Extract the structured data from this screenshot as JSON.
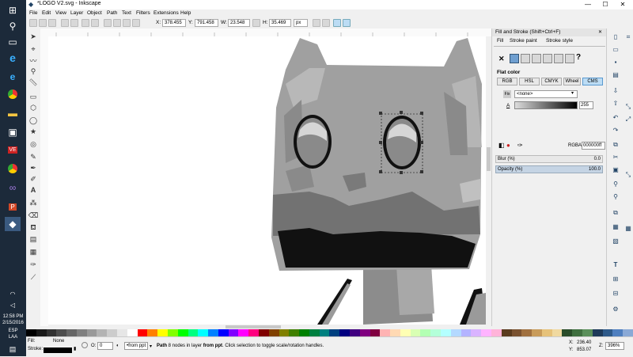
{
  "window": {
    "title": "*LOGO V2.svg - Inkscape",
    "controls": [
      "—",
      "☐",
      "✕"
    ]
  },
  "menu": [
    "File",
    "Edit",
    "View",
    "Layer",
    "Object",
    "Path",
    "Text",
    "Filters",
    "Extensions",
    "Help"
  ],
  "toolbar": {
    "x_label": "X:",
    "x_value": "378.455",
    "y_label": "Y:",
    "y_value": "791.458",
    "w_label": "W:",
    "w_value": "23.548",
    "h_label": "H:",
    "h_value": "35.469",
    "unit": "px"
  },
  "dialog": {
    "title": "Fill and Stroke (Shift+Ctrl+F)",
    "tabs": [
      "Fill",
      "Stroke paint",
      "Stroke style"
    ],
    "x_mark": "✕",
    "question_mark": "?",
    "flat_color_label": "Flat color",
    "color_modes": [
      "RGB",
      "HSL",
      "CMYK",
      "Wheel",
      "CMS"
    ],
    "none_option": "<none>",
    "alpha_label": "A",
    "alpha_value": "255",
    "rgba_label": "RGBA:",
    "rgba_value": "000000ff",
    "blur_label": "Blur (%)",
    "blur_value": "0.0",
    "opacity_label": "Opacity (%)",
    "opacity_value": "100.0"
  },
  "status": {
    "fill_label": "Fill:",
    "fill_value": "None",
    "stroke_label": "Stroke:",
    "opacity_label": "O:",
    "opacity_value": "0",
    "layer": "•from ppt",
    "message_prefix": "Path",
    "message_mid": " 8 nodes in layer ",
    "message_layer": "from ppt",
    "message_suffix": ". Click selection to toggle scale/rotation handles.",
    "x_label": "X:",
    "x_value": "236.40",
    "y_label": "Y:",
    "y_value": "853.07",
    "z_label": "Z:",
    "zoom_value": "396%"
  },
  "taskbar": {
    "time": "12:58 PM",
    "date": "2/15/2016",
    "lang1": "ESP",
    "lang2": "LAA"
  },
  "palette_colors": [
    "#000000",
    "#1a1a1a",
    "#333333",
    "#4d4d4d",
    "#666666",
    "#808080",
    "#999999",
    "#b3b3b3",
    "#cccccc",
    "#e6e6e6",
    "#ffffff",
    "#ff0000",
    "#ff8000",
    "#ffff00",
    "#80ff00",
    "#00ff00",
    "#00ff80",
    "#00ffff",
    "#0080ff",
    "#0000ff",
    "#8000ff",
    "#ff00ff",
    "#ff0080",
    "#800000",
    "#804000",
    "#808000",
    "#408000",
    "#008000",
    "#008040",
    "#008080",
    "#004080",
    "#000080",
    "#400080",
    "#800080",
    "#800040",
    "#ffb3b3",
    "#ffd9b3",
    "#ffffb3",
    "#d9ffb3",
    "#b3ffb3",
    "#b3ffd9",
    "#b3ffff",
    "#b3d9ff",
    "#b3b3ff",
    "#d9b3ff",
    "#ffb3ff",
    "#ffb3d9",
    "#5a3b1e",
    "#7a5230",
    "#a0703f",
    "#c89b5a",
    "#e6c27a",
    "#f0d9a0",
    "#2a4d2a",
    "#3f6f3f",
    "#5a8f5a",
    "#1e3a5a",
    "#2e5a8a",
    "#4f7fbf",
    "#8aa9d6"
  ]
}
